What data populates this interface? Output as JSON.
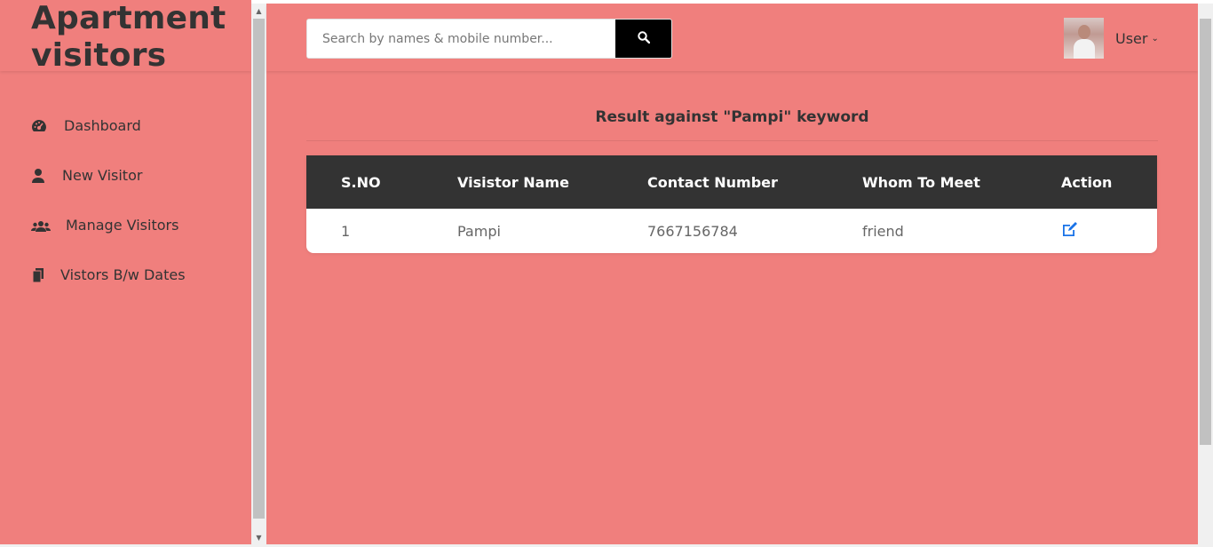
{
  "app": {
    "brand_line1": "Apartment",
    "brand_line2": "visitors"
  },
  "sidebar": {
    "items": [
      {
        "label": "Dashboard",
        "icon": "dashboard-icon"
      },
      {
        "label": "New Visitor",
        "icon": "user-icon"
      },
      {
        "label": "Manage Visitors",
        "icon": "users-icon"
      },
      {
        "label": "Vistors B/w Dates",
        "icon": "copy-icon"
      }
    ]
  },
  "search": {
    "placeholder": "Search by names & mobile number...",
    "value": "",
    "button_icon": "search-icon"
  },
  "user": {
    "name": "User",
    "avatar": "user-avatar-photo",
    "chevron": "chevron-down-icon"
  },
  "results": {
    "title": "Result against \"Pampi\" keyword",
    "headers": [
      "S.NO",
      "Visistor Name",
      "Contact Number",
      "Whom To Meet",
      "Action"
    ],
    "rows": [
      {
        "sno": "1",
        "name": "Pampi",
        "contact": "7667156784",
        "whom": "friend",
        "action_icon": "edit-icon"
      }
    ]
  },
  "colors": {
    "background": "#f07f7d",
    "table_header": "#333333",
    "action_link": "#1a73e8"
  }
}
